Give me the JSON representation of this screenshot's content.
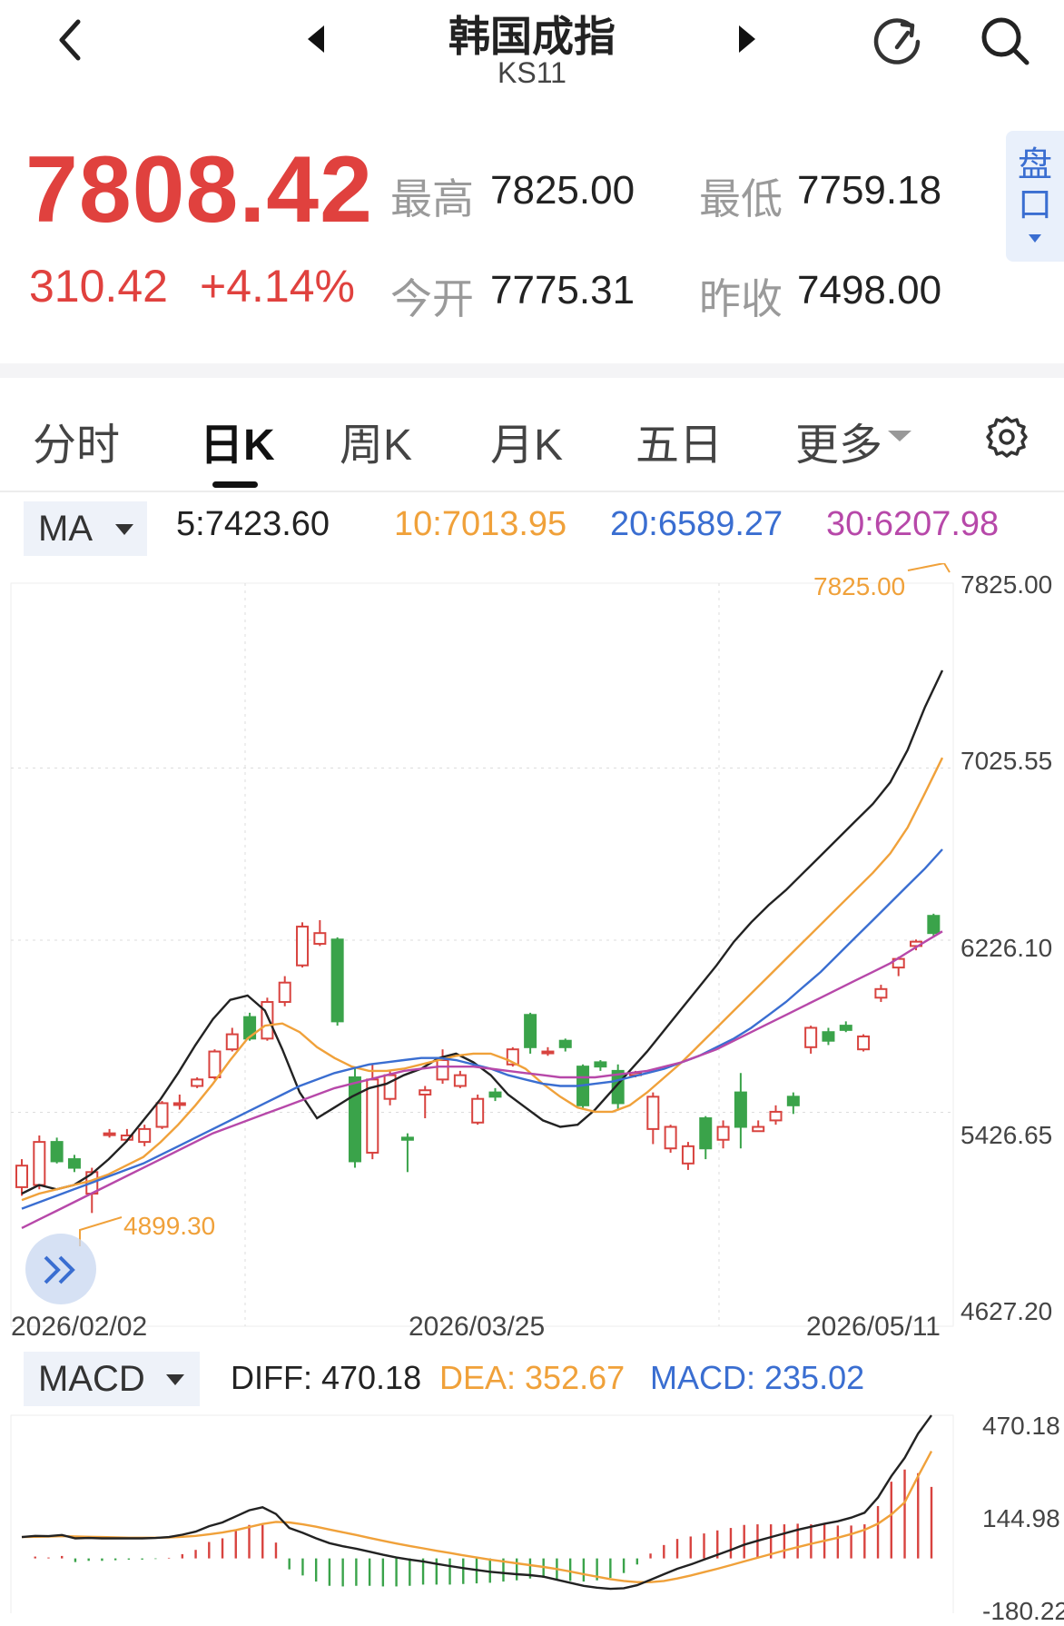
{
  "header": {
    "title": "韩国成指",
    "code": "KS11"
  },
  "quote": {
    "price": "7808.42",
    "change": "310.42",
    "change_pct": "+4.14%",
    "high_label": "最高",
    "high": "7825.00",
    "low_label": "最低",
    "low": "7759.18",
    "open_label": "今开",
    "open": "7775.31",
    "prev_close_label": "昨收",
    "prev_close": "7498.00",
    "side_tab": "盘口",
    "up_color": "#e0413e"
  },
  "tabs": [
    {
      "label": "分时",
      "active": false
    },
    {
      "label": "日K",
      "active": true
    },
    {
      "label": "周K",
      "active": false
    },
    {
      "label": "月K",
      "active": false
    },
    {
      "label": "五日",
      "active": false
    },
    {
      "label": "更多",
      "active": false
    }
  ],
  "ma_bar": {
    "selector": "MA",
    "ma5": "5:7423.60",
    "ma10": "10:7013.95",
    "ma20": "20:6589.27",
    "ma30": "30:6207.98"
  },
  "macd_bar": {
    "selector": "MACD",
    "diff": "DIFF: 470.18",
    "dea": "DEA: 352.67",
    "macd": "MACD: 235.02"
  },
  "chart_data": [
    {
      "type": "candlestick",
      "title": "",
      "y_ticks": [
        "7825.00",
        "7025.55",
        "6226.10",
        "5426.65",
        "4627.20"
      ],
      "ylim": [
        4627.2,
        7825.0
      ],
      "x_ticks": [
        "2026/02/02",
        "2026/03/25",
        "2026/05/11"
      ],
      "max_annotation": "7825.00",
      "min_annotation": "4899.30",
      "series": [
        {
          "name": "MA5",
          "color": "#222222",
          "values": [
            4990,
            5030,
            5010,
            5030,
            5080,
            5150,
            5230,
            5330,
            5430,
            5550,
            5680,
            5800,
            5890,
            5910,
            5840,
            5660,
            5460,
            5340,
            5390,
            5440,
            5480,
            5500,
            5540,
            5570,
            5620,
            5640,
            5600,
            5540,
            5450,
            5390,
            5330,
            5300,
            5310,
            5380,
            5470,
            5560,
            5650,
            5750,
            5850,
            5950,
            6050,
            6160,
            6250,
            6330,
            6400,
            6480,
            6560,
            6640,
            6720,
            6800,
            6900,
            7050,
            7250,
            7420
          ]
        },
        {
          "name": "MA10",
          "color": "#f0a13a",
          "values": [
            4960,
            4990,
            5010,
            5030,
            5050,
            5080,
            5120,
            5160,
            5230,
            5310,
            5400,
            5500,
            5610,
            5710,
            5770,
            5780,
            5740,
            5670,
            5620,
            5580,
            5560,
            5560,
            5570,
            5590,
            5610,
            5630,
            5640,
            5640,
            5610,
            5570,
            5500,
            5440,
            5390,
            5370,
            5370,
            5400,
            5460,
            5530,
            5600,
            5680,
            5760,
            5840,
            5920,
            6000,
            6080,
            6160,
            6240,
            6320,
            6400,
            6480,
            6570,
            6690,
            6850,
            7014
          ]
        },
        {
          "name": "MA20",
          "color": "#3a6ed1",
          "values": [
            4920,
            4950,
            4980,
            5010,
            5040,
            5070,
            5100,
            5130,
            5170,
            5210,
            5250,
            5290,
            5330,
            5370,
            5410,
            5450,
            5490,
            5520,
            5550,
            5570,
            5590,
            5600,
            5610,
            5620,
            5620,
            5610,
            5590,
            5570,
            5540,
            5520,
            5500,
            5490,
            5490,
            5500,
            5510,
            5530,
            5550,
            5570,
            5600,
            5630,
            5670,
            5710,
            5760,
            5820,
            5880,
            5950,
            6020,
            6100,
            6180,
            6260,
            6340,
            6420,
            6500,
            6589
          ]
        },
        {
          "name": "MA30",
          "color": "#b748a9",
          "values": [
            4830,
            4870,
            4910,
            4950,
            4990,
            5030,
            5070,
            5110,
            5150,
            5190,
            5230,
            5270,
            5300,
            5330,
            5360,
            5390,
            5420,
            5450,
            5480,
            5500,
            5520,
            5540,
            5560,
            5570,
            5580,
            5580,
            5580,
            5570,
            5560,
            5550,
            5540,
            5530,
            5530,
            5530,
            5540,
            5550,
            5560,
            5580,
            5600,
            5630,
            5660,
            5700,
            5740,
            5780,
            5820,
            5860,
            5900,
            5940,
            5980,
            6020,
            6060,
            6110,
            6160,
            6208
          ]
        }
      ],
      "candles": [
        [
          5020,
          5120,
          4980,
          5150
        ],
        [
          5030,
          5230,
          5010,
          5260
        ],
        [
          5230,
          5140,
          5130,
          5250
        ],
        [
          5150,
          5110,
          5090,
          5170
        ],
        [
          4990,
          5090,
          4900,
          5110
        ],
        [
          5270,
          5270,
          5250,
          5290
        ],
        [
          5240,
          5260,
          5230,
          5290
        ],
        [
          5230,
          5290,
          5210,
          5310
        ],
        [
          5300,
          5410,
          5290,
          5420
        ],
        [
          5410,
          5410,
          5380,
          5450
        ],
        [
          5490,
          5520,
          5480,
          5530
        ],
        [
          5530,
          5650,
          5520,
          5660
        ],
        [
          5660,
          5730,
          5650,
          5760
        ],
        [
          5810,
          5710,
          5700,
          5830
        ],
        [
          5710,
          5880,
          5700,
          5900
        ],
        [
          5880,
          5970,
          5860,
          6000
        ],
        [
          6050,
          6230,
          6040,
          6250
        ],
        [
          6150,
          6200,
          6140,
          6260
        ],
        [
          6170,
          5790,
          5770,
          6180
        ],
        [
          5530,
          5140,
          5110,
          5580
        ],
        [
          5180,
          5520,
          5150,
          5590
        ],
        [
          5430,
          5540,
          5400,
          5560
        ],
        [
          5250,
          5240,
          5090,
          5270
        ],
        [
          5450,
          5470,
          5340,
          5490
        ],
        [
          5520,
          5610,
          5500,
          5660
        ],
        [
          5490,
          5540,
          5480,
          5560
        ],
        [
          5320,
          5430,
          5310,
          5450
        ],
        [
          5460,
          5440,
          5420,
          5480
        ],
        [
          5590,
          5660,
          5580,
          5670
        ],
        [
          5820,
          5670,
          5640,
          5830
        ],
        [
          5650,
          5650,
          5630,
          5670
        ],
        [
          5700,
          5670,
          5650,
          5710
        ],
        [
          5580,
          5400,
          5380,
          5590
        ],
        [
          5600,
          5580,
          5560,
          5610
        ],
        [
          5560,
          5410,
          5380,
          5590
        ],
        [
          5540,
          5550,
          5530,
          5560
        ],
        [
          5290,
          5440,
          5220,
          5460
        ],
        [
          5200,
          5300,
          5180,
          5310
        ],
        [
          5130,
          5210,
          5100,
          5230
        ],
        [
          5340,
          5200,
          5150,
          5350
        ],
        [
          5240,
          5300,
          5200,
          5330
        ],
        [
          5460,
          5300,
          5200,
          5550
        ],
        [
          5280,
          5300,
          5280,
          5330
        ],
        [
          5330,
          5370,
          5310,
          5400
        ],
        [
          5440,
          5400,
          5360,
          5460
        ],
        [
          5670,
          5760,
          5640,
          5770
        ],
        [
          5740,
          5700,
          5680,
          5760
        ],
        [
          5770,
          5750,
          5740,
          5790
        ],
        [
          5660,
          5720,
          5650,
          5730
        ],
        [
          5900,
          5940,
          5880,
          5960
        ],
        [
          6040,
          6080,
          6000,
          6090
        ],
        [
          6140,
          6160,
          6120,
          6170
        ],
        [
          6280,
          6200,
          6180,
          6290
        ]
      ]
    },
    {
      "type": "macd",
      "title": "",
      "y_ticks": [
        "470.18",
        "144.98",
        "-180.22"
      ],
      "ylim": [
        -180.22,
        470.18
      ],
      "diff": [
        70,
        74,
        73,
        77,
        66,
        67,
        66,
        66,
        66,
        66,
        67,
        70,
        78,
        88,
        106,
        118,
        138,
        158,
        168,
        146,
        100,
        84,
        66,
        50,
        40,
        32,
        22,
        12,
        3,
        -4,
        -10,
        -18,
        -25,
        -32,
        -38,
        -44,
        -48,
        -52,
        -55,
        -60,
        -70,
        -80,
        -90,
        -96,
        -100,
        -98,
        -88,
        -70,
        -52,
        -34,
        -20,
        -4,
        12,
        28,
        45,
        58,
        70,
        82,
        94,
        104,
        114,
        122,
        134,
        150,
        200,
        270,
        330,
        410,
        470
      ],
      "dea": [
        70,
        71,
        72,
        73,
        72,
        71,
        70,
        69,
        68,
        68,
        68,
        69,
        71,
        74,
        79,
        85,
        93,
        103,
        113,
        120,
        118,
        112,
        104,
        95,
        86,
        77,
        67,
        58,
        49,
        41,
        33,
        25,
        18,
        10,
        3,
        -4,
        -10,
        -16,
        -22,
        -28,
        -35,
        -43,
        -52,
        -60,
        -68,
        -74,
        -78,
        -78,
        -74,
        -66,
        -56,
        -45,
        -34,
        -22,
        -10,
        2,
        14,
        26,
        37,
        48,
        58,
        68,
        80,
        94,
        114,
        144,
        184,
        270,
        352
      ],
      "hist": [
        0,
        6,
        3,
        8,
        -12,
        -8,
        -8,
        -6,
        -4,
        -4,
        -2,
        2,
        14,
        28,
        54,
        66,
        90,
        110,
        110,
        52,
        -36,
        -56,
        -76,
        -90,
        -92,
        -90,
        -90,
        -92,
        -92,
        -90,
        -86,
        -86,
        -86,
        -84,
        -82,
        -80,
        -76,
        -72,
        -66,
        -64,
        -70,
        -74,
        -76,
        -72,
        -64,
        -48,
        -20,
        16,
        44,
        64,
        72,
        82,
        92,
        100,
        110,
        112,
        112,
        112,
        114,
        112,
        112,
        108,
        108,
        112,
        172,
        252,
        292,
        280,
        235
      ]
    }
  ]
}
